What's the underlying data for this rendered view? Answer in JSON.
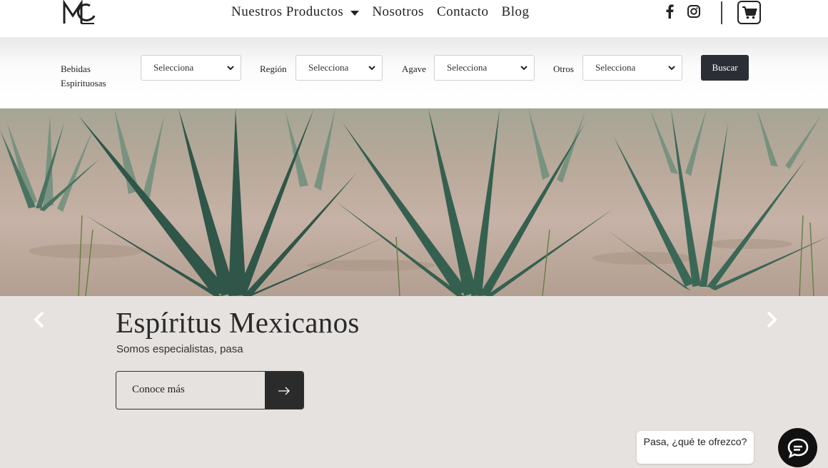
{
  "header": {
    "logo_icon": "monogram-logo",
    "nav": [
      {
        "label": "Nuestros Productos",
        "has_dropdown": true
      },
      {
        "label": "Nosotros"
      },
      {
        "label": "Contacto"
      },
      {
        "label": "Blog"
      }
    ],
    "social_icons": [
      "facebook-icon",
      "instagram-icon"
    ],
    "cart_icon": "shopping-cart-icon"
  },
  "filters": {
    "bebidas": {
      "label_line1": "Bebidas",
      "label_line2": "Espirituosas",
      "value": "Selecciona"
    },
    "region": {
      "label": "Región",
      "value": "Selecciona"
    },
    "agave": {
      "label": "Agave",
      "value": "Selecciona"
    },
    "otros": {
      "label": "Otros",
      "value": "Selecciona"
    },
    "search_button": "Buscar"
  },
  "hero": {
    "image": "agave-field-photo",
    "title": "Espíritus Mexicanos",
    "subtitle": "Somos especialistas, pasa",
    "cta_label": "Conoce más",
    "cta_icon": "arrow-right-icon",
    "prev_icon": "chevron-left-icon",
    "next_icon": "chevron-right-icon"
  },
  "chat": {
    "message": "Pasa, ¿qué te ofrezco?",
    "icon": "chat-icon"
  },
  "colors": {
    "dark": "#2b2f35",
    "hero_bg": "#e6e2df"
  }
}
